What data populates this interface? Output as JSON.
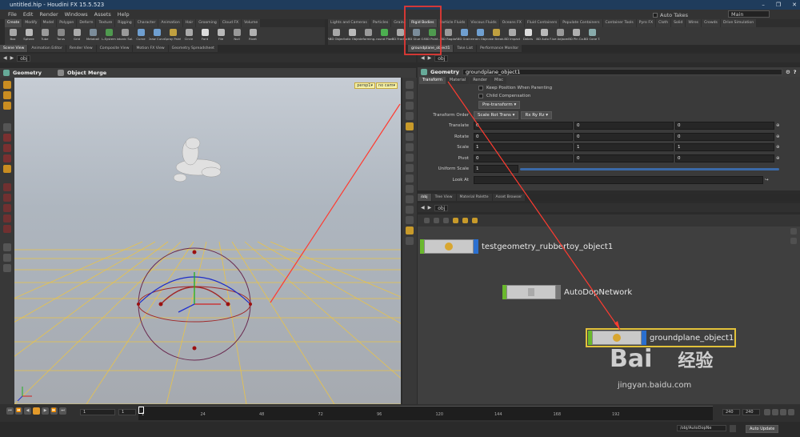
{
  "window": {
    "title": "untitled.hip - Houdini FX 15.5.523",
    "controls": [
      "–",
      "❐",
      "✕"
    ]
  },
  "menu": {
    "items": [
      "File",
      "Edit",
      "Render",
      "Windows",
      "Assets",
      "Help"
    ],
    "auto_takes": "Auto Takes",
    "desktop": "Main"
  },
  "shelf_left": {
    "tabs": [
      "Create",
      "Modify",
      "Model",
      "Polygon",
      "Deform",
      "Texture",
      "Rigging",
      "Character",
      "Animation",
      "Hair",
      "Grooming",
      "Cloud FX",
      "Volume"
    ],
    "tools": [
      "Box",
      "Sphere",
      "Tube",
      "Torus",
      "Grid",
      "Metaball",
      "L-System",
      "Platonic Sol...",
      "Curve",
      "Draw Curve",
      "Spray Paint",
      "Circle",
      "Font",
      "File",
      "Null",
      "Rivet"
    ]
  },
  "shelf_right": {
    "tabs": [
      "Lights and Cameras",
      "Particles",
      "Grains",
      "Rigid Bodies",
      "Particle Fluids",
      "Viscous Fluids",
      "Oceans FX",
      "Fluid Containers",
      "Populate Containers",
      "Container Tools",
      "Pyro FX",
      "Cloth",
      "Solid",
      "Wires",
      "Crowds",
      "Drive Simulation"
    ],
    "tools": [
      "RBD Object",
      "Static Object",
      "Deforming...",
      "Ground Plane",
      "RBD Fractur...",
      "RBD Glue O...",
      "RBD Point...",
      "RBD Ragdol",
      "RBD Grains",
      "Terrain Object",
      "Make Break...",
      "RBD Impacts",
      "Debris",
      "RBD Auto F...",
      "Glue Adjacent",
      "RBD Pin Co...",
      "RBD Cone T..."
    ]
  },
  "left_pane": {
    "tabs": [
      "Scene View",
      "Animation Editor",
      "Render View",
      "Composite View",
      "Motion FX View",
      "Geometry Spreadsheet"
    ],
    "path": "obj",
    "header_context": "Geometry",
    "header_tool": "Object Merge",
    "camera": "persp1",
    "cam_menu": "no cam"
  },
  "param_pane": {
    "tabs": [
      "groundplane_object1",
      "Take List",
      "Performance Monitor"
    ],
    "path": "obj",
    "node_type": "Geometry",
    "node_name": "groundplane_object1",
    "param_tabs": [
      "Transform",
      "Material",
      "Render",
      "Misc"
    ],
    "keep_position": "Keep Position When Parenting",
    "child_compensation": "Child Compensation",
    "pre_transform": "Pre-transform",
    "transform_order_label": "Transform Order",
    "transform_order": "Scale Rot Trans",
    "rotate_order": "Rx Ry Rz",
    "rows": [
      {
        "label": "Translate",
        "values": [
          "0",
          "0",
          "0"
        ]
      },
      {
        "label": "Rotate",
        "values": [
          "0",
          "0",
          "0"
        ]
      },
      {
        "label": "Scale",
        "values": [
          "1",
          "1",
          "1"
        ]
      },
      {
        "label": "Pivot",
        "values": [
          "0",
          "0",
          "0"
        ]
      }
    ],
    "uniform_scale_label": "Uniform Scale",
    "uniform_scale": "1",
    "look_at_label": "Look At"
  },
  "network_pane": {
    "tabs": [
      "/obj",
      "Tree View",
      "Material Palette",
      "Asset Browser"
    ],
    "path": "obj",
    "nodes": [
      {
        "name": "testgeometry_rubbertoy_object1"
      },
      {
        "name": "AutoDopNetwork"
      },
      {
        "name": "groundplane_object1"
      }
    ]
  },
  "timeline": {
    "frame": "1",
    "start": "1",
    "ticks": [
      "1",
      "24",
      "48",
      "72",
      "96",
      "120",
      "144",
      "168",
      "192"
    ],
    "end_a": "240",
    "end_b": "240"
  },
  "status": {
    "path": "/obj/AutoDopNe",
    "auto_update": "Auto Update"
  },
  "watermark": {
    "text": "Bai",
    "text2": "经验",
    "url": "jingyan.baidu.com"
  },
  "colors": {
    "highlight_box": "#e53935",
    "arrow": "#ff3b30",
    "grid": "#e8c34a",
    "node_green": "#6ab82d",
    "node_blue": "#2a6fd0"
  }
}
